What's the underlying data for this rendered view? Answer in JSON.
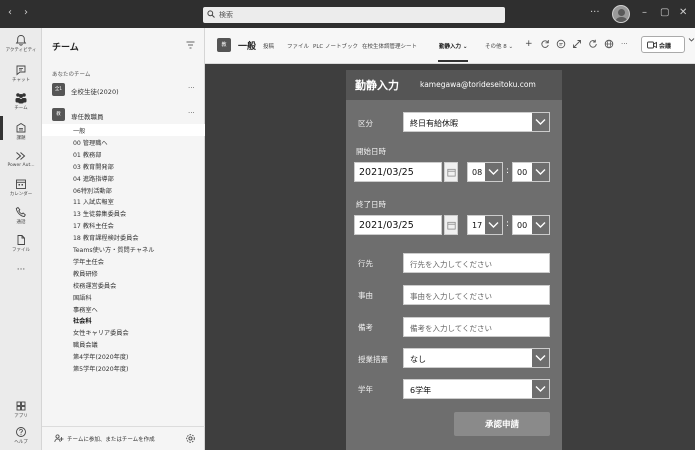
{
  "titlebar": {
    "back": "‹",
    "forward": "›",
    "search_placeholder": "検索",
    "minimize": "–",
    "maximize": "▢",
    "close": "✕",
    "more": "···"
  },
  "rail": [
    {
      "label": "アクティビティ",
      "icon": "bell-icon"
    },
    {
      "label": "チャット",
      "icon": "chat-icon"
    },
    {
      "label": "チーム",
      "icon": "teams-icon"
    },
    {
      "label": "課題",
      "icon": "assignments-icon"
    },
    {
      "label": "Power Aut...",
      "icon": "power-automate-icon"
    },
    {
      "label": "カレンダー",
      "icon": "calendar-icon"
    },
    {
      "label": "通話",
      "icon": "phone-icon"
    },
    {
      "label": "ファイル",
      "icon": "file-icon"
    },
    {
      "label": "···",
      "icon": "more-icon"
    },
    {
      "label": "アプリ",
      "icon": "apps-icon"
    },
    {
      "label": "ヘルプ",
      "icon": "help-icon"
    }
  ],
  "panel": {
    "title": "チーム",
    "section_label": "あなたのチーム",
    "teams": [
      {
        "badge": "全1",
        "name": "全校生徒(2020)",
        "more": "···"
      },
      {
        "badge": "教",
        "name": "専任教職員",
        "more": "···"
      }
    ],
    "channels": [
      {
        "name": "一般",
        "bold": false
      },
      {
        "name": "00 管理職へ",
        "bold": false
      },
      {
        "name": "01 教務部",
        "bold": false
      },
      {
        "name": "03 教育開発部",
        "bold": false
      },
      {
        "name": "04 進路指導部",
        "bold": false
      },
      {
        "name": "06特別活動部",
        "bold": false
      },
      {
        "name": "11 入試広報室",
        "bold": false
      },
      {
        "name": "13 生徒募集委員会",
        "bold": false
      },
      {
        "name": "17 教科主任会",
        "bold": false
      },
      {
        "name": "18 教育課程検討委員会",
        "bold": false
      },
      {
        "name": "Teams使い方・質問チャネル",
        "bold": false
      },
      {
        "name": "学年主任会",
        "bold": false
      },
      {
        "name": "教員研修",
        "bold": false
      },
      {
        "name": "校務運営委員会",
        "bold": false
      },
      {
        "name": "国語科",
        "bold": false
      },
      {
        "name": "事務室へ",
        "bold": false
      },
      {
        "name": "社会科",
        "bold": true
      },
      {
        "name": "女性キャリア委員会",
        "bold": false
      },
      {
        "name": "職員会議",
        "bold": false
      },
      {
        "name": "第4学年(2020年度)",
        "bold": false
      },
      {
        "name": "第5学年(2020年度)",
        "bold": false
      }
    ],
    "footer_text": "チームに参加、またはチームを作成"
  },
  "header": {
    "badge": "教",
    "channel_name": "一般",
    "tabs": [
      "投稿",
      "ファイル",
      "PLC ノートブック",
      "在校生体調管理シート",
      "勤静入力 ⌄",
      "その他 8 ⌄",
      "+"
    ],
    "active_tab_index": 4,
    "meet_label": "会議"
  },
  "form": {
    "title": "勤静入力",
    "email": "kamegawa@torideseitoku.com",
    "kubun_label": "区分",
    "kubun_value": "終日有給休暇",
    "start_label": "開始日時",
    "start_date": "2021/03/25",
    "start_hour": "08",
    "start_min": "00",
    "end_label": "終了日時",
    "end_date": "2021/03/25",
    "end_hour": "17",
    "end_min": "00",
    "dest_label": "行先",
    "dest_placeholder": "行先を入力してください",
    "reason_label": "事由",
    "reason_placeholder": "事由を入力してください",
    "note_label": "備考",
    "note_placeholder": "備考を入力してください",
    "class_label": "授業措置",
    "class_value": "なし",
    "grade_label": "学年",
    "grade_value": "6学年",
    "submit_label": "承認申請"
  },
  "colors": {
    "form_bg": "#6e6e6e",
    "form_header": "#555555",
    "content_bg": "#3e3e3e",
    "titlebar": "#2f2f2f"
  }
}
